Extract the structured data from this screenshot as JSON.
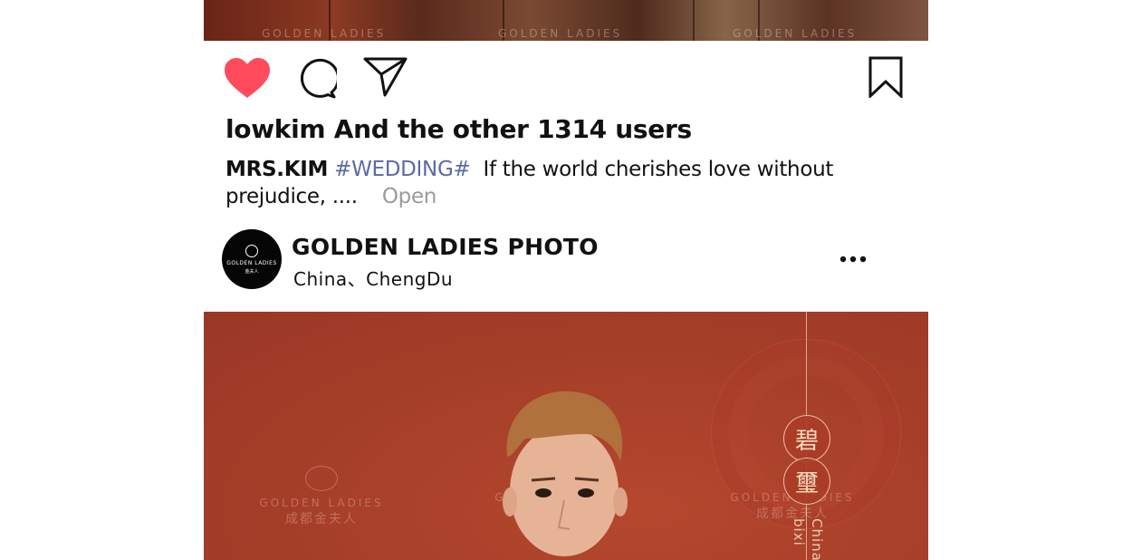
{
  "prev_post": {
    "photo_icon": "photo-strip",
    "watermark": "GOLDEN LADIES"
  },
  "actions": {
    "like_icon": "heart-icon",
    "comment_icon": "comment-icon",
    "share_icon": "send-icon",
    "save_icon": "bookmark-icon",
    "like_color": "#ff4b5c"
  },
  "likes_text": "lowkim And the other 1314 users",
  "caption": {
    "username": "MRS.KIM",
    "hashtag": "#WEDDING#",
    "text": "If the world cherishes love without prejudice, ....",
    "more_label": "Open"
  },
  "next_post": {
    "avatar_text_top": "GOLDEN LADIES",
    "avatar_text_bottom": "金夫人",
    "account_name": "GOLDEN LADIES PHOTO",
    "location": "China、ChengDu",
    "more_icon": "more-dots-icon"
  },
  "main_photo": {
    "watermark_brand": "GOLDEN LADIES",
    "watermark_city": "成都金夫人",
    "seal_1": "碧",
    "seal_2": "璽",
    "vertical_text_1": "bixi",
    "vertical_text_2": "China"
  }
}
